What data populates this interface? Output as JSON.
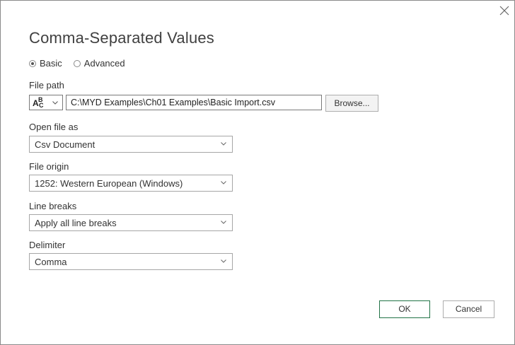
{
  "dialog": {
    "title": "Comma-Separated Values",
    "close_icon": "close-icon"
  },
  "mode": {
    "options": [
      {
        "label": "Basic",
        "selected": true
      },
      {
        "label": "Advanced",
        "selected": false
      }
    ]
  },
  "file_path": {
    "label": "File path",
    "type_icon": "abc-text-type-icon",
    "value": "C:\\MYD Examples\\Ch01 Examples\\Basic Import.csv",
    "browse_label": "Browse..."
  },
  "open_file_as": {
    "label": "Open file as",
    "value": "Csv Document"
  },
  "file_origin": {
    "label": "File origin",
    "value": "1252: Western European (Windows)"
  },
  "line_breaks": {
    "label": "Line breaks",
    "value": "Apply all line breaks"
  },
  "delimiter": {
    "label": "Delimiter",
    "value": "Comma"
  },
  "footer": {
    "ok_label": "OK",
    "cancel_label": "Cancel"
  },
  "colors": {
    "ok_border": "#217346",
    "title": "#404040"
  }
}
